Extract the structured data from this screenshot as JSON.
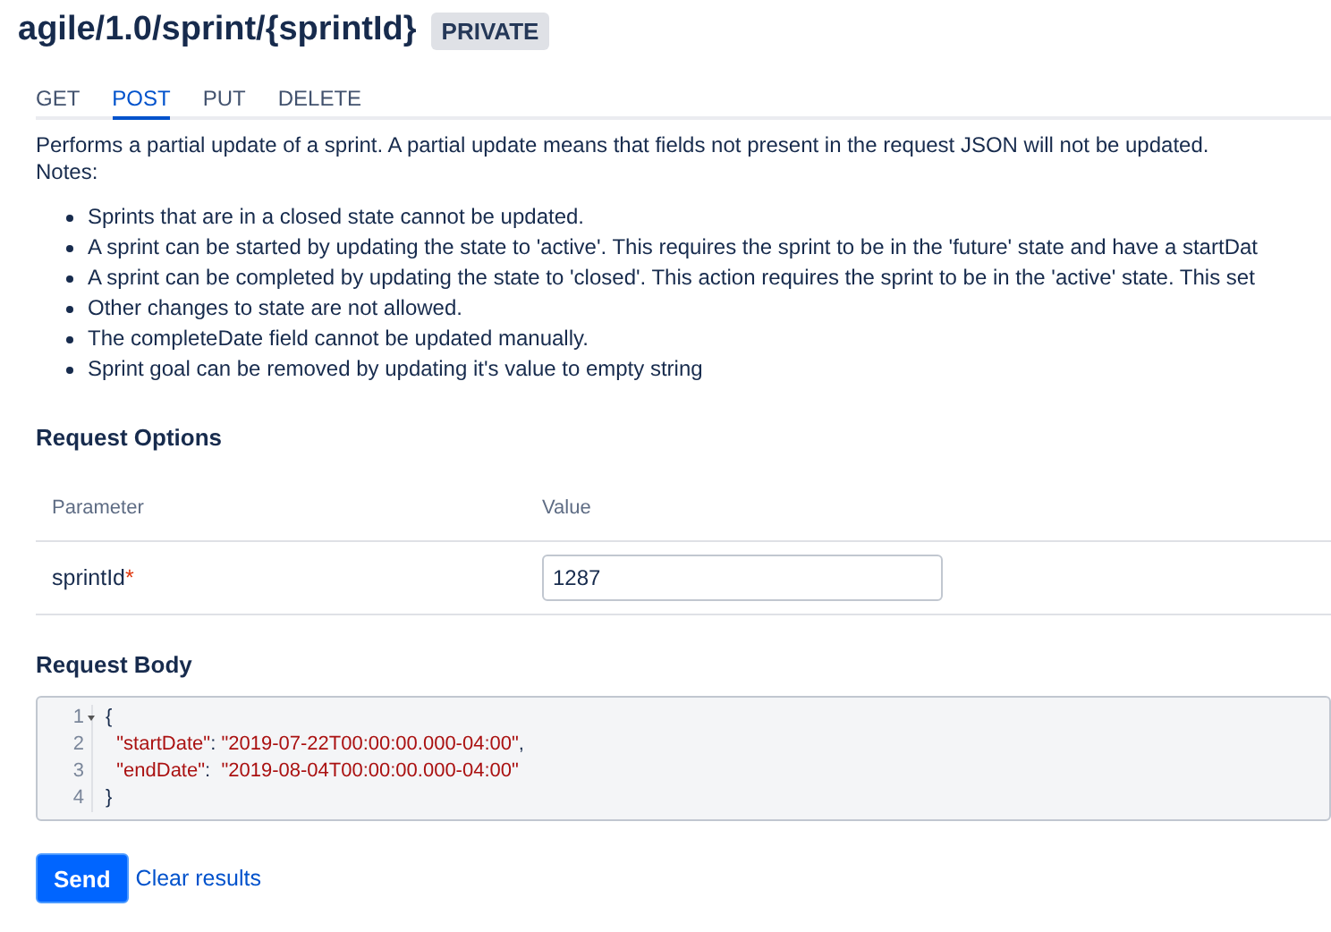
{
  "header": {
    "path": "agile/1.0/sprint/{sprintId}",
    "badge": "PRIVATE"
  },
  "tabs": [
    {
      "label": "GET",
      "selected": false
    },
    {
      "label": "POST",
      "selected": true
    },
    {
      "label": "PUT",
      "selected": false
    },
    {
      "label": "DELETE",
      "selected": false
    }
  ],
  "description": "Performs a partial update of a sprint. A partial update means that fields not present in the request JSON will not be updated.",
  "notes_label": "Notes:",
  "notes": [
    "Sprints that are in a closed state cannot be updated.",
    "A sprint can be started by updating the state to 'active'. This requires the sprint to be in the 'future' state and have a startDat",
    "A sprint can be completed by updating the state to 'closed'. This action requires the sprint to be in the 'active' state. This set",
    "Other changes to state are not allowed.",
    "The completeDate field cannot be updated manually.",
    "Sprint goal can be removed by updating it's value to empty string"
  ],
  "request_options": {
    "title": "Request Options",
    "columns": [
      "Parameter",
      "Value"
    ],
    "rows": [
      {
        "name": "sprintId",
        "required_mark": "*",
        "value": "1287"
      }
    ]
  },
  "request_body": {
    "title": "Request Body",
    "lines": [
      {
        "number": "1",
        "foldable": true,
        "tokens": [
          {
            "kind": "punct",
            "text": "{"
          }
        ]
      },
      {
        "number": "2",
        "foldable": false,
        "tokens": [
          {
            "kind": "key",
            "text": "  \"startDate\""
          },
          {
            "kind": "punct",
            "text": ": "
          },
          {
            "kind": "string",
            "text": "\"2019-07-22T00:00:00.000-04:00\""
          },
          {
            "kind": "punct",
            "text": ","
          }
        ]
      },
      {
        "number": "3",
        "foldable": false,
        "tokens": [
          {
            "kind": "key",
            "text": "  \"endDate\""
          },
          {
            "kind": "punct",
            "text": ":  "
          },
          {
            "kind": "string",
            "text": "\"2019-08-04T00:00:00.000-04:00\""
          }
        ]
      },
      {
        "number": "4",
        "foldable": false,
        "tokens": [
          {
            "kind": "punct",
            "text": "}"
          }
        ]
      }
    ]
  },
  "actions": {
    "send": "Send",
    "clear": "Clear results"
  }
}
